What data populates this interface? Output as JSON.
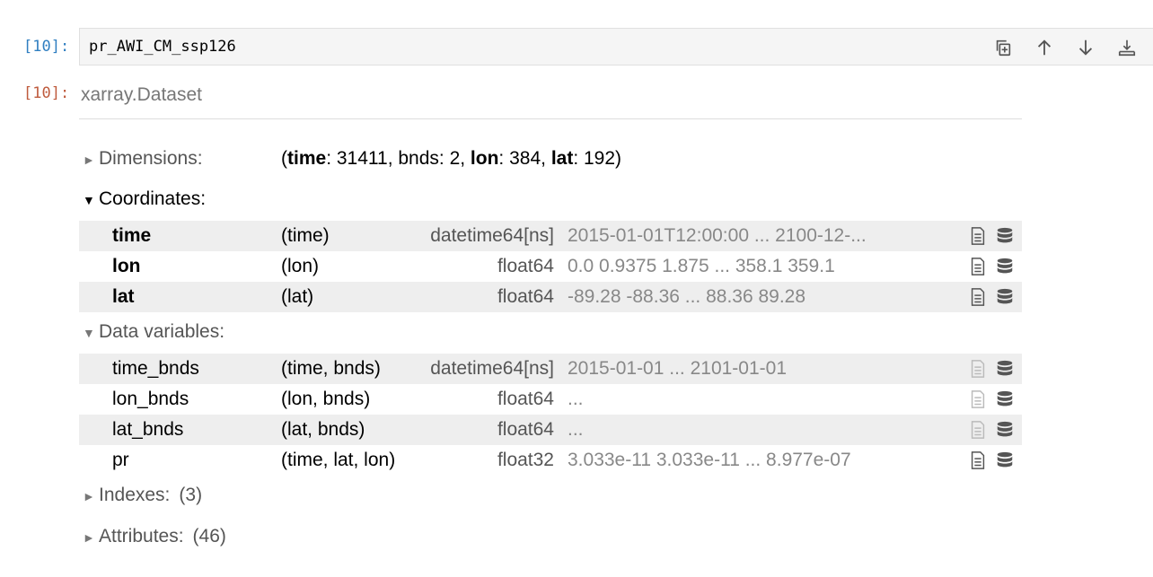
{
  "cell": {
    "in_prompt": "[10]:",
    "out_prompt": "[10]:",
    "code": "pr_AWI_CM_ssp126",
    "toolbar": [
      "duplicate-icon",
      "move-up-icon",
      "move-down-icon",
      "insert-below-icon"
    ]
  },
  "output": {
    "title": "xarray.Dataset",
    "dimensions": {
      "label": "Dimensions:",
      "open_paren": "(",
      "time_key": "time",
      "time_val": ": 31411, bnds: 2, ",
      "lon_key": "lon",
      "lon_val": ": 384, ",
      "lat_key": "lat",
      "lat_val": ": 192)"
    },
    "coordinates": {
      "label": "Coordinates:",
      "rows": [
        {
          "name": "time",
          "dims": "(time)",
          "dtype": "datetime64[ns]",
          "preview": "2015-01-01T12:00:00 ... 2100-12-..."
        },
        {
          "name": "lon",
          "dims": "(lon)",
          "dtype": "float64",
          "preview": "0.0 0.9375 1.875 ... 358.1 359.1"
        },
        {
          "name": "lat",
          "dims": "(lat)",
          "dtype": "float64",
          "preview": "-89.28 -88.36 ... 88.36 89.28"
        }
      ]
    },
    "data_variables": {
      "label": "Data variables:",
      "rows": [
        {
          "name": "time_bnds",
          "dims": "(time, bnds)",
          "dtype": "datetime64[ns]",
          "preview": "2015-01-01 ... 2101-01-01"
        },
        {
          "name": "lon_bnds",
          "dims": "(lon, bnds)",
          "dtype": "float64",
          "preview": "..."
        },
        {
          "name": "lat_bnds",
          "dims": "(lat, bnds)",
          "dtype": "float64",
          "preview": "..."
        },
        {
          "name": "pr",
          "dims": "(time, lat, lon)",
          "dtype": "float32",
          "preview": "3.033e-11 3.033e-11 ... 8.977e-07"
        }
      ]
    },
    "indexes": {
      "label": "Indexes:",
      "count": "(3)"
    },
    "attributes": {
      "label": "Attributes:",
      "count": "(46)"
    }
  },
  "colors": {
    "in_prompt": "#307fc1",
    "out_prompt": "#bf5b3d",
    "row_alt": "#eeeeee"
  }
}
